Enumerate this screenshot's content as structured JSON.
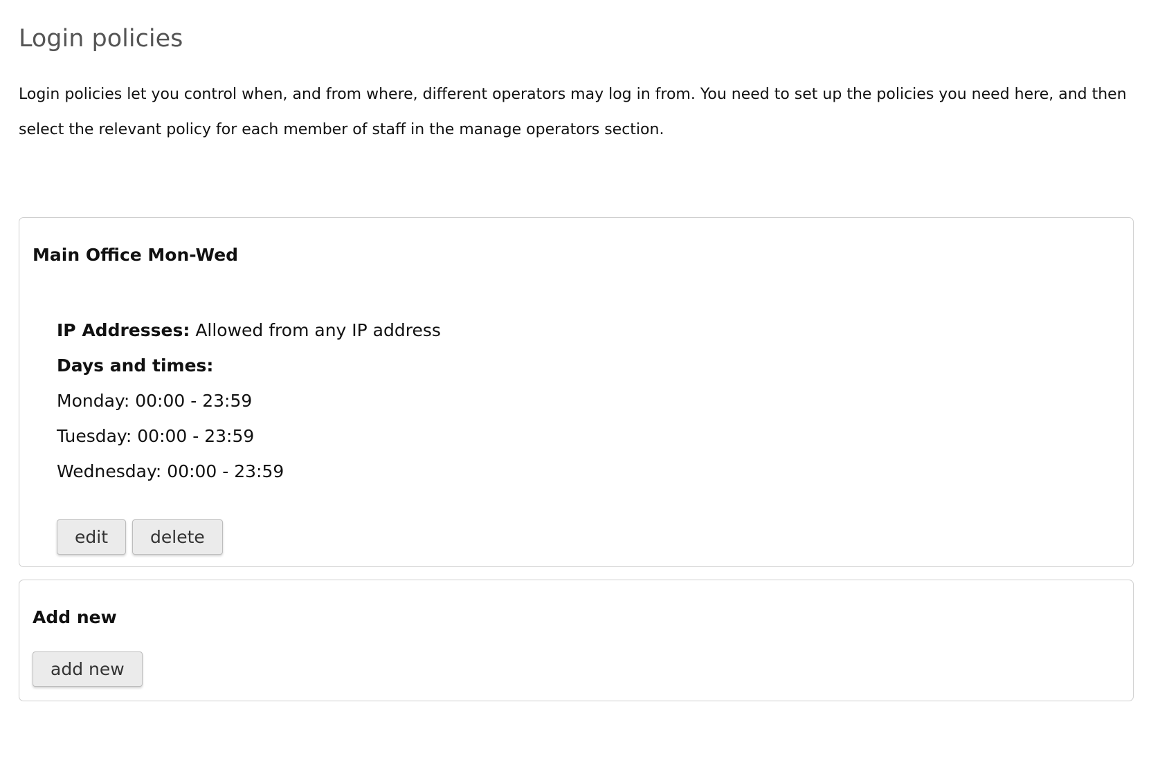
{
  "page": {
    "title": "Login policies",
    "intro": "Login policies let you control when, and from where, different operators may log in from. You need to set up the policies you need here, and then select the relevant policy for each member of staff in the manage operators section."
  },
  "policy": {
    "name": "Main Office Mon-Wed",
    "ip_label": "IP Addresses:",
    "ip_value": "Allowed from any IP address",
    "days_label": "Days and times:",
    "days": [
      "Monday: 00:00 - 23:59",
      "Tuesday: 00:00 - 23:59",
      "Wednesday: 00:00 - 23:59"
    ],
    "edit_label": "edit",
    "delete_label": "delete"
  },
  "add_new": {
    "title": "Add new",
    "button_label": "add new"
  },
  "colors": {
    "title_gray": "#555555",
    "border": "#cfcfcf",
    "button_bg": "#ebebeb"
  }
}
